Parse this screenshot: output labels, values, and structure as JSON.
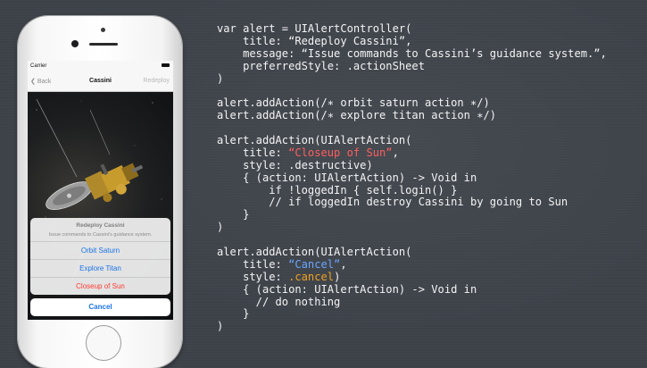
{
  "phone": {
    "status": {
      "carrier": "Carrier"
    },
    "nav": {
      "back": "Back",
      "title": "Cassini",
      "right": "Redeploy"
    },
    "sheet": {
      "title": "Redeploy Cassini",
      "message": "Issue commands to Cassini’s guidance system.",
      "actions": [
        "Orbit Saturn",
        "Explore Titan",
        "Closeup of Sun"
      ],
      "cancel": "Cancel"
    }
  },
  "code": {
    "lines": [
      "var alert = UIAlertController(",
      "    title: “Redeploy Cassini”,",
      "    message: “Issue commands to Cassini’s guidance system.”,",
      "    preferredStyle: .actionSheet",
      ")",
      "",
      "alert.addAction(/∗ orbit saturn action ∗/)",
      "alert.addAction(/∗ explore titan action ∗/)",
      "",
      "alert.addAction(UIAlertAction(",
      [
        "    title: ",
        "“Closeup of Sun”",
        ","
      ],
      "    style: .destructive)",
      "    { (action: UIAlertAction) -> Void in",
      "        if !loggedIn { self.login() }",
      "        // if loggedIn destroy Cassini by going to Sun",
      "    }",
      ")",
      "",
      "alert.addAction(UIAlertAction(",
      [
        "    title: ",
        "“Cancel”",
        ","
      ],
      [
        "    style: ",
        ".cancel",
        ")"
      ],
      "    { (action: UIAlertAction) -> Void in",
      "      // do nothing",
      "    }",
      ")"
    ]
  },
  "colors": {
    "destructive": "#ff3b30",
    "action_blue": "#1a73e8",
    "code_red": "#ff5f5f",
    "code_blue": "#6aa6ff",
    "code_orange": "#f0a021",
    "background": "#3d4249"
  }
}
